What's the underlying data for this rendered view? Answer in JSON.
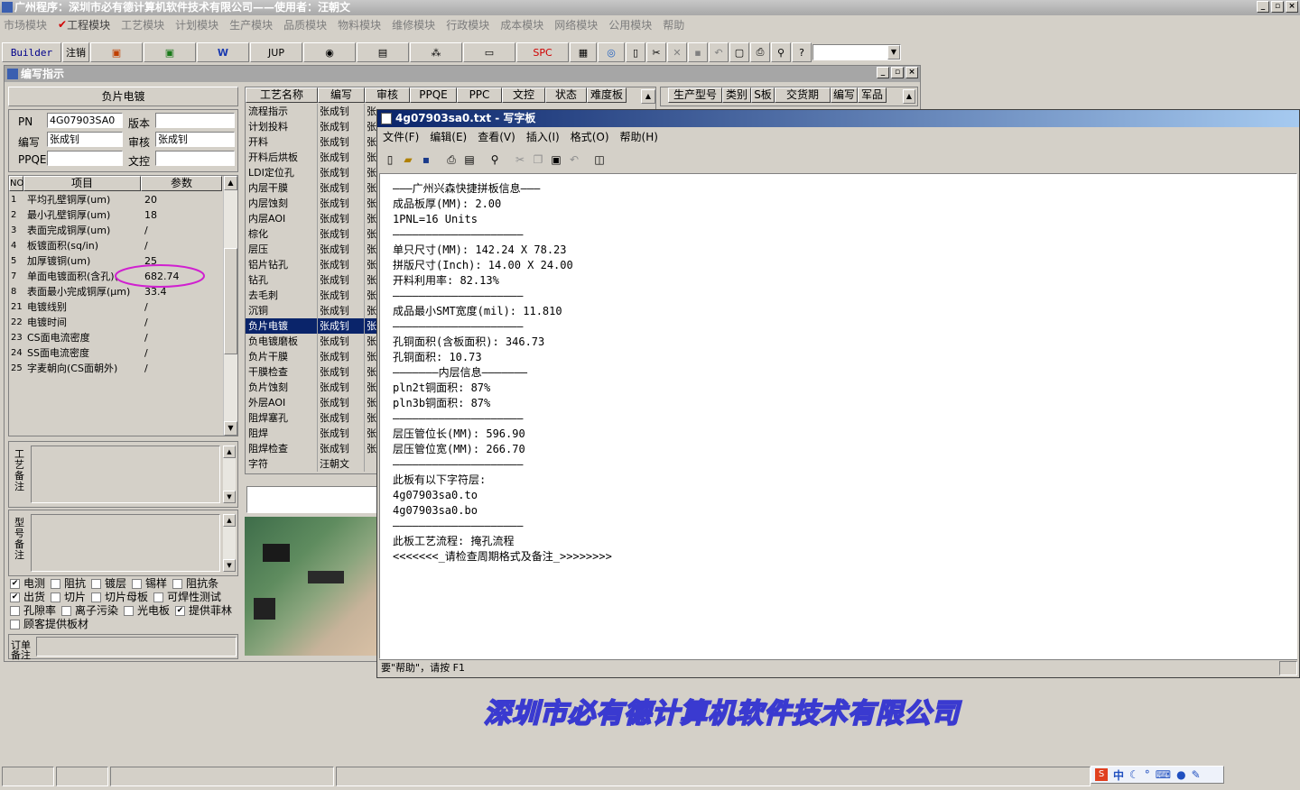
{
  "app": {
    "title": "广州程序：深圳市必有德计算机软件技术有限公司——使用者：汪朝文"
  },
  "menu": [
    "市场模块",
    "工程模块",
    "工艺模块",
    "计划模块",
    "生产模块",
    "品质模块",
    "物料模块",
    "维修模块",
    "行政模块",
    "成本模块",
    "网络模块",
    "公用模块",
    "帮助"
  ],
  "toolbar": {
    "builder": "Builder",
    "logout": "注销",
    "jup": "JUP",
    "spc": "SPC"
  },
  "left": {
    "window_title": "编写指示",
    "section": "负片电镀",
    "pn_label": "PN",
    "pn_value": "4G07903SA0",
    "version_label": "版本",
    "version_value": "",
    "writer_label": "编写",
    "writer_value": "张成钊",
    "review_label": "审核",
    "review_value": "张成钊",
    "ppqe_label": "PPQE",
    "ppqe_value": "",
    "doc_label": "文控",
    "doc_value": "",
    "params_header": {
      "no": "NO",
      "item": "项目",
      "param": "参数"
    },
    "params": [
      {
        "no": "1",
        "item": "平均孔壁铜厚(um)",
        "val": "20"
      },
      {
        "no": "2",
        "item": "最小孔壁铜厚(um)",
        "val": "18"
      },
      {
        "no": "3",
        "item": "表面完成铜厚(um)",
        "val": "/"
      },
      {
        "no": "4",
        "item": "板镀面积(sq/in)",
        "val": "/"
      },
      {
        "no": "5",
        "item": "加厚镀铜(um)",
        "val": "25"
      },
      {
        "no": "7",
        "item": "单面电镀面积(含孔)(",
        "val": "682.74"
      },
      {
        "no": "8",
        "item": "表面最小完成铜厚(μm)",
        "val": "33.4"
      },
      {
        "no": "21",
        "item": "电镀线别",
        "val": "/"
      },
      {
        "no": "22",
        "item": "电镀时间",
        "val": "/"
      },
      {
        "no": "23",
        "item": "CS面电流密度",
        "val": "/"
      },
      {
        "no": "24",
        "item": "SS面电流密度",
        "val": "/"
      },
      {
        "no": "25",
        "item": "字麦朝向(CS面朝外)",
        "val": "/"
      }
    ],
    "note1_label": "工艺备注",
    "note2_label": "型号备注",
    "order_label": "订单备注",
    "checks": [
      {
        "label": "电测",
        "checked": true
      },
      {
        "label": "阻抗",
        "checked": false
      },
      {
        "label": "镀层",
        "checked": false
      },
      {
        "label": "锡样",
        "checked": false
      },
      {
        "label": "阻抗条",
        "checked": false
      },
      {
        "label": "出货",
        "checked": true
      },
      {
        "label": "切片",
        "checked": false
      },
      {
        "label": "切片母板",
        "checked": false
      },
      {
        "label": "可焊性测试",
        "checked": false
      },
      {
        "label": "孔隙率",
        "checked": false
      },
      {
        "label": "离子污染",
        "checked": false
      },
      {
        "label": "光电板",
        "checked": false
      },
      {
        "label": "提供菲林",
        "checked": true
      },
      {
        "label": "顾客提供板材",
        "checked": false
      }
    ]
  },
  "process": {
    "headers": [
      "工艺名称",
      "编写",
      "审核",
      "PPQE",
      "PPC",
      "文控",
      "状态",
      "难度板"
    ],
    "rows": [
      {
        "name": "流程指示",
        "writer": "张成钊",
        "rev": "张"
      },
      {
        "name": "计划投料",
        "writer": "张成钊",
        "rev": "张"
      },
      {
        "name": "开料",
        "writer": "张成钊",
        "rev": "张"
      },
      {
        "name": "开料后烘板",
        "writer": "张成钊",
        "rev": "张"
      },
      {
        "name": "LDI定位孔",
        "writer": "张成钊",
        "rev": "张"
      },
      {
        "name": "内层干膜",
        "writer": "张成钊",
        "rev": "张"
      },
      {
        "name": "内层蚀刻",
        "writer": "张成钊",
        "rev": "张"
      },
      {
        "name": "内层AOI",
        "writer": "张成钊",
        "rev": "张"
      },
      {
        "name": "棕化",
        "writer": "张成钊",
        "rev": "张"
      },
      {
        "name": "层压",
        "writer": "张成钊",
        "rev": "张"
      },
      {
        "name": "铝片钻孔",
        "writer": "张成钊",
        "rev": "张"
      },
      {
        "name": "钻孔",
        "writer": "张成钊",
        "rev": "张"
      },
      {
        "name": "去毛刺",
        "writer": "张成钊",
        "rev": "张"
      },
      {
        "name": "沉铜",
        "writer": "张成钊",
        "rev": "张"
      },
      {
        "name": "负片电镀",
        "writer": "张成钊",
        "rev": "张"
      },
      {
        "name": "负电镀磨板",
        "writer": "张成钊",
        "rev": "张"
      },
      {
        "name": "负片干膜",
        "writer": "张成钊",
        "rev": "张"
      },
      {
        "name": "干膜检查",
        "writer": "张成钊",
        "rev": "张"
      },
      {
        "name": "负片蚀刻",
        "writer": "张成钊",
        "rev": "张"
      },
      {
        "name": "外层AOI",
        "writer": "张成钊",
        "rev": "张"
      },
      {
        "name": "阻焊塞孔",
        "writer": "张成钊",
        "rev": "张"
      },
      {
        "name": "阻焊",
        "writer": "张成钊",
        "rev": "张"
      },
      {
        "name": "阻焊检查",
        "writer": "张成钊",
        "rev": "张"
      },
      {
        "name": "字符",
        "writer": "汪朝文",
        "rev": ""
      }
    ]
  },
  "right_headers": [
    "生产型号",
    "类别",
    "S板",
    "交货期",
    "编写",
    "军品"
  ],
  "notepad": {
    "title": "4g07903sa0.txt - 写字板",
    "menu": [
      "文件(F)",
      "编辑(E)",
      "查看(V)",
      "插入(I)",
      "格式(O)",
      "帮助(H)"
    ],
    "lines": [
      "———广州兴森快捷拼板信息———",
      "成品板厚(MM): 2.00",
      "1PNL=16 Units",
      "————————————————————",
      "单只尺寸(MM): 142.24 X 78.23",
      "拼版尺寸(Inch): 14.00 X 24.00",
      "开料利用率: 82.13%",
      "————————————————————",
      "成品最小SMT宽度(mil): 11.810",
      "————————————————————",
      "孔铜面积(含板面积): 346.73",
      "孔铜面积: 10.73",
      "———————内层信息———————",
      "pln2t铜面积: 87%",
      "pln3b铜面积: 87%",
      "————————————————————",
      "层压管位长(MM): 596.90",
      "层压管位宽(MM): 266.70",
      "————————————————————",
      "此板有以下字符层:",
      "4g07903sa0.to",
      "4g07903sa0.bo",
      "————————————————————",
      "此板工艺流程: 掩孔流程",
      "<<<<<<<_请检查周期格式及备注_>>>>>>>>"
    ],
    "status": "要\"帮助\"，请按 F1"
  },
  "watermark": "深圳市必有德计算机软件技术有限公司",
  "ime": "中"
}
